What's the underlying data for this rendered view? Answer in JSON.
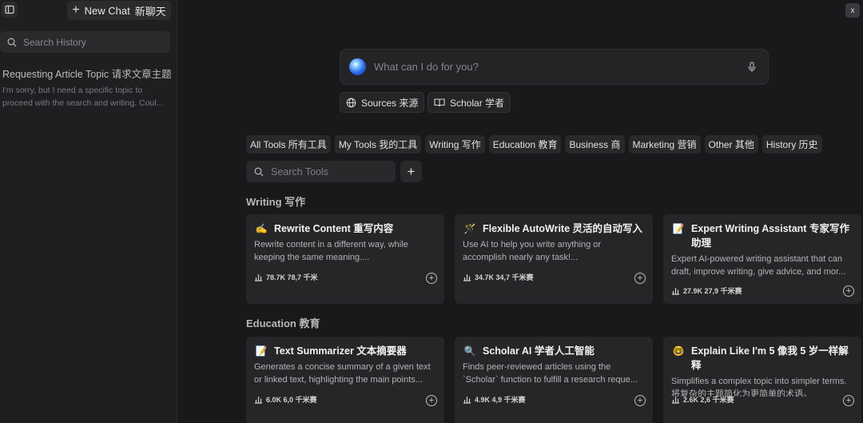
{
  "sidebar": {
    "new_chat_label": "New Chat",
    "new_chat_cn": "新聊天",
    "search_placeholder": "Search History",
    "history": [
      {
        "title": "Requesting Article Topic 请求文章主题",
        "preview_line1": "I'm sorry, but I need a specific topic to",
        "preview_line2": "proceed with the search and writing. Coul..."
      }
    ]
  },
  "close_label": "x",
  "prompt": {
    "placeholder": "What can I do for you?"
  },
  "chips": {
    "sources": "Sources 来源",
    "scholar": "Scholar 学者"
  },
  "tabs": [
    "All Tools 所有工具",
    "My Tools 我的工具",
    "Writing 写作",
    "Education 教育",
    "Business 商",
    "Marketing 营销",
    "Other 其他",
    "History 历史"
  ],
  "tool_search_placeholder": "Search Tools",
  "sections": {
    "writing": {
      "label": "Writing 写作",
      "cards": [
        {
          "icon": "✍️",
          "title": "Rewrite Content 重写内容",
          "desc1": "Rewrite content in a different way, while",
          "desc2": "keeping the same meaning....",
          "stats": "78.7K 78,7 千米"
        },
        {
          "icon": "🪄",
          "title": "Flexible AutoWrite 灵活的自动写入",
          "desc1": "Use AI to help you write anything or",
          "desc2": "accomplish nearly any task!...",
          "stats": "34.7K 34,7 千米赛"
        },
        {
          "icon": "📝",
          "title": "Expert Writing Assistant 专家写作助理",
          "desc1": "Expert AI-powered writing assistant that can",
          "desc2": "draft, improve writing, give advice, and mor...",
          "stats": "27.9K 27,9 千米赛"
        }
      ]
    },
    "education": {
      "label": "Education 教育",
      "cards": [
        {
          "icon": "📝",
          "title": "Text Summarizer 文本摘要器",
          "desc1": "Generates a concise summary of a given text",
          "desc2": "or linked text, highlighting the main points...",
          "stats": "6.0K 6,0 千米赛"
        },
        {
          "icon": "🔍",
          "title": "Scholar AI 学者人工智能",
          "desc1": "Finds peer-reviewed articles using the",
          "desc2": "`Scholar` function to fulfill a research reque...",
          "stats": "4.9K 4,9 千米赛"
        },
        {
          "icon": "🤓",
          "title": "Explain Like I'm 5 像我 5 岁一样解释",
          "desc1": "Simplifies a complex topic into simpler terms.",
          "desc2": "将复杂的主题简化为更简单的术语。",
          "stats": "2.6K 2,6 千米赛"
        }
      ]
    }
  }
}
